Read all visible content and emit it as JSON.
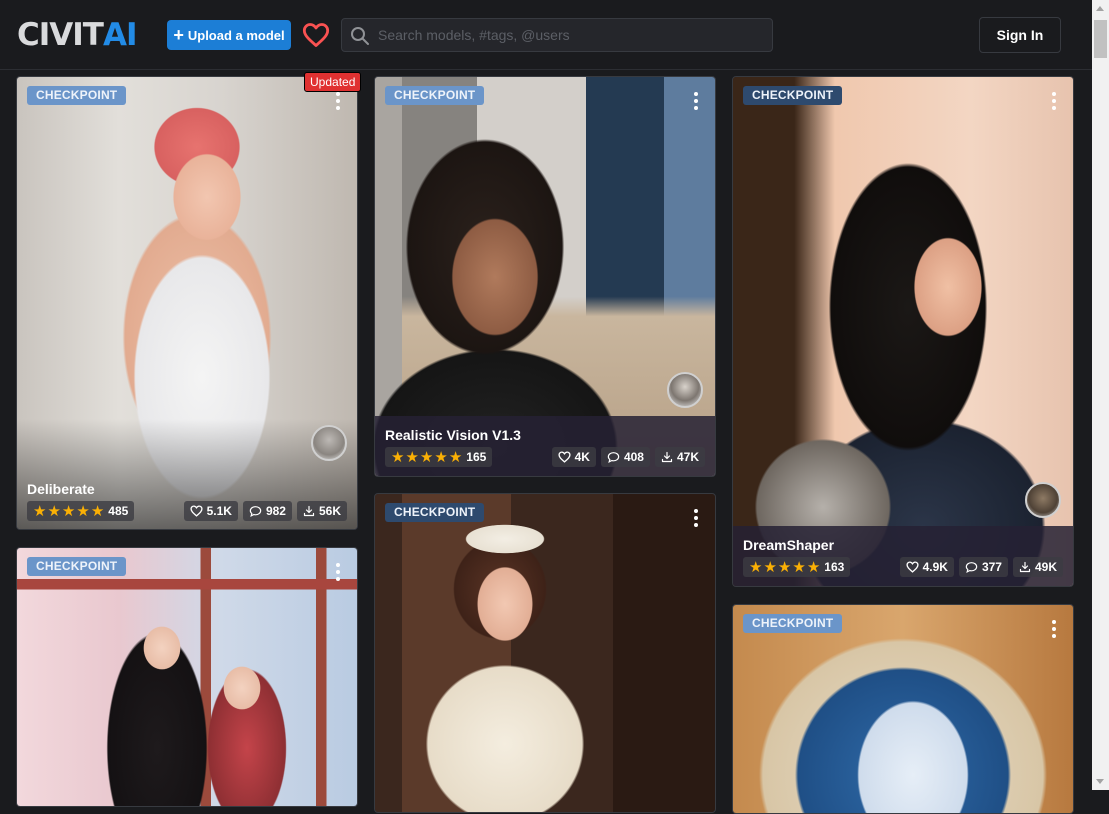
{
  "header": {
    "logo_part1": "CIVIT",
    "logo_part2": "AI",
    "upload_label": "Upload a model",
    "search_placeholder": "Search models, #tags, @users",
    "signin_label": "Sign In"
  },
  "cards": [
    {
      "badge": "CHECKPOINT",
      "updated": "Updated",
      "title": "Deliberate",
      "rating_count": "485",
      "likes": "5.1K",
      "comments": "982",
      "downloads": "56K"
    },
    {
      "badge": "CHECKPOINT",
      "title": "Realistic Vision V1.3",
      "rating_count": "165",
      "likes": "4K",
      "comments": "408",
      "downloads": "47K"
    },
    {
      "badge": "CHECKPOINT",
      "title": "DreamShaper",
      "rating_count": "163",
      "likes": "4.9K",
      "comments": "377",
      "downloads": "49K"
    },
    {
      "badge": "CHECKPOINT"
    },
    {
      "badge": "CHECKPOINT"
    },
    {
      "badge": "CHECKPOINT"
    }
  ],
  "colors": {
    "background": "#1a1b1e",
    "primary": "#1c7ed6",
    "heart": "#fa5252",
    "star": "#fab005",
    "updated": "#e03131"
  },
  "icons": [
    "search-icon",
    "heart-icon",
    "plus-icon",
    "star-icon",
    "comment-icon",
    "download-icon",
    "more-dots-icon"
  ]
}
